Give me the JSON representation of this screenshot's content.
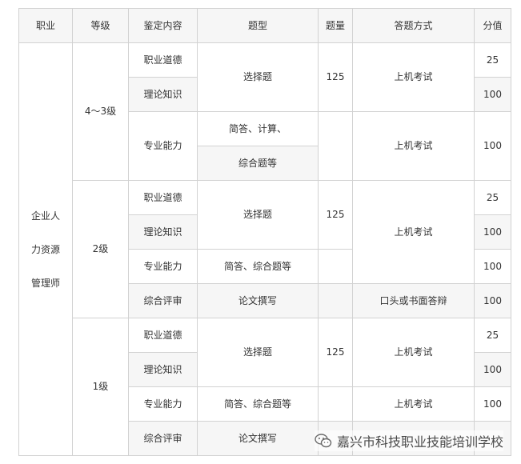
{
  "headers": [
    "职业",
    "等级",
    "鉴定内容",
    "题型",
    "题量",
    "答题方式",
    "分值"
  ],
  "occupation": [
    "企业人",
    "力资源",
    "管理师"
  ],
  "levels": [
    {
      "name": "4～3级",
      "rows": [
        {
          "content": "职业道德",
          "score": "25"
        },
        {
          "content": "理论知识",
          "score": "100"
        },
        {
          "content": "专业能力",
          "score": "100"
        }
      ],
      "type_objective": "选择题",
      "count": "125",
      "method_theory": "上机考试",
      "type_skill": [
        "简答、计算、",
        "综合题等"
      ],
      "method_skill": "上机考试"
    },
    {
      "name": "2级",
      "rows": [
        {
          "content": "职业道德",
          "score": "25"
        },
        {
          "content": "理论知识",
          "score": "100"
        },
        {
          "content": "专业能力",
          "score": "100"
        },
        {
          "content": "综合评审",
          "score": "100"
        }
      ],
      "type_objective": "选择题",
      "count": "125",
      "method_theory": "上机考试",
      "type_skill": "简答、综合题等",
      "type_review": "论文撰写",
      "method_review": "口头或书面答辩"
    },
    {
      "name": "1级",
      "rows": [
        {
          "content": "职业道德",
          "score": "25"
        },
        {
          "content": "理论知识",
          "score": "100"
        },
        {
          "content": "专业能力",
          "score": "100"
        },
        {
          "content": "综合评审",
          "score": ""
        }
      ],
      "type_objective": "选择题",
      "count": "125",
      "method_theory": "上机考试",
      "type_skill": "简答、综合题等",
      "method_skill": "上机考试",
      "type_review": "论文撰写"
    }
  ],
  "watermark": {
    "text": "嘉兴市科技职业技能培训学校",
    "icon": "wechat-icon"
  }
}
